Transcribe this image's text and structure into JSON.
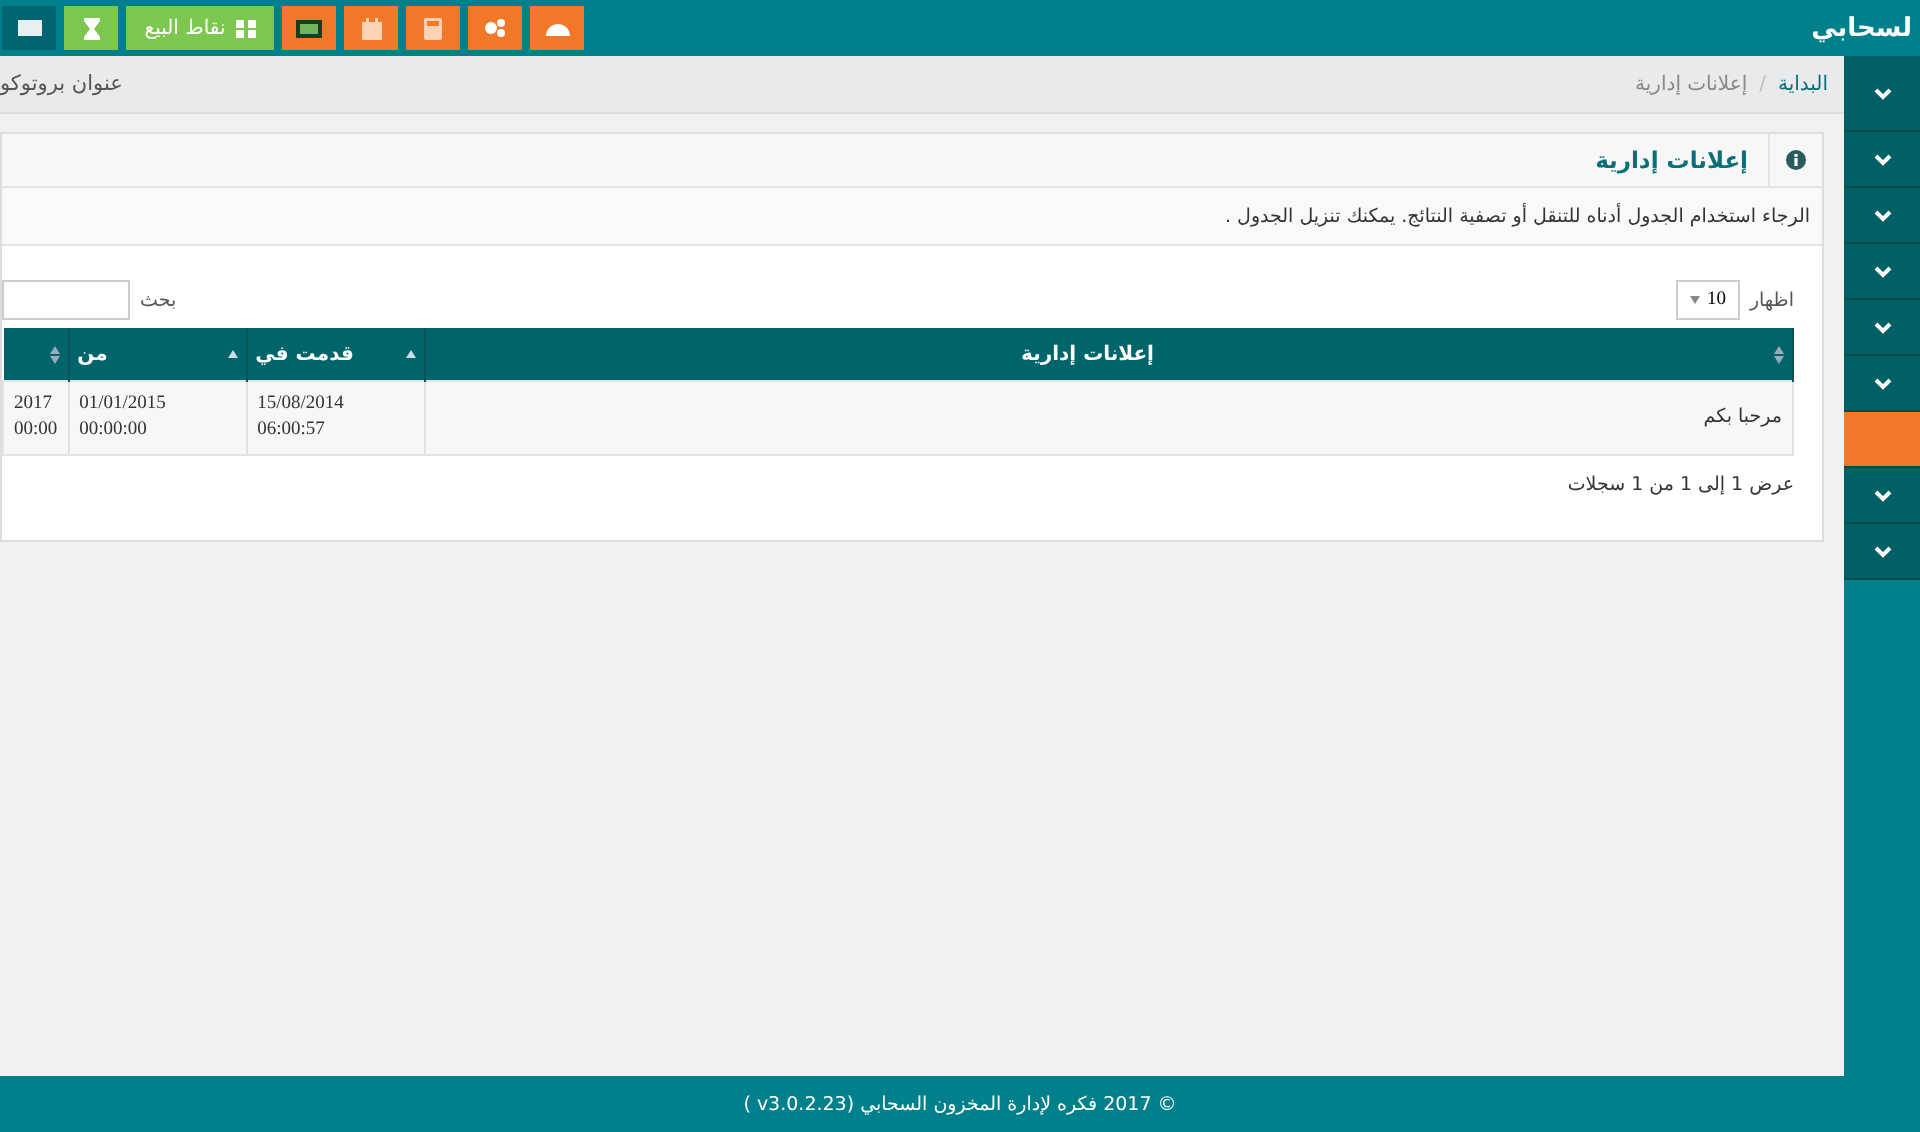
{
  "topbar": {
    "logo": "لسحابي",
    "buttons": [
      {
        "kind": "menu",
        "color": "#006570"
      },
      {
        "kind": "hourglass",
        "color": "#7dc64f"
      },
      {
        "kind": "pos",
        "label": "نقاط البيع",
        "color": "#7dc64f"
      },
      {
        "kind": "screen",
        "color": "#f07828"
      },
      {
        "kind": "calendar",
        "color": "#f07828"
      },
      {
        "kind": "calculator",
        "color": "#f07828"
      },
      {
        "kind": "cogs",
        "color": "#f07828"
      },
      {
        "kind": "dashboard",
        "color": "#f07828"
      }
    ]
  },
  "breadcrumb": {
    "items": [
      "البداية",
      "إعلانات إدارية"
    ],
    "separator": "/",
    "right_text": "عنوان بروتوكو"
  },
  "sidebar": {
    "items": [
      {
        "selected": false
      },
      {
        "selected": false
      },
      {
        "selected": false
      },
      {
        "selected": false
      },
      {
        "selected": false
      },
      {
        "selected": false
      },
      {
        "selected": true
      },
      {
        "selected": false
      },
      {
        "selected": false
      }
    ]
  },
  "panel": {
    "title": "إعلانات إدارية",
    "description": "الرجاء استخدام الجدول أدناه للتنقل أو تصفية النتائج. يمكنك تنزيل الجدول .",
    "show_label": "اظهار",
    "page_size": "10",
    "search_label": "بحث",
    "table": {
      "columns": [
        {
          "label": "إعلانات إدارية",
          "sorted_ascending": false
        },
        {
          "label": "قدمت في",
          "sorted_ascending": true
        },
        {
          "label": "من",
          "sorted_ascending": true
        },
        {
          "sorted_ascending": false
        }
      ],
      "rows": [
        {
          "cells": [
            [
              "مرحبا بكم"
            ],
            [
              "15/08/2014",
              "06:00:57"
            ],
            [
              "01/01/2015",
              "00:00:00"
            ],
            [
              "2017",
              "00:00"
            ]
          ]
        }
      ]
    },
    "info": "عرض 1 إلى 1 من 1 سجلات"
  },
  "footer": "© 2017 فكره لإدارة المخزون السحابي (v3.0.2.23 )"
}
